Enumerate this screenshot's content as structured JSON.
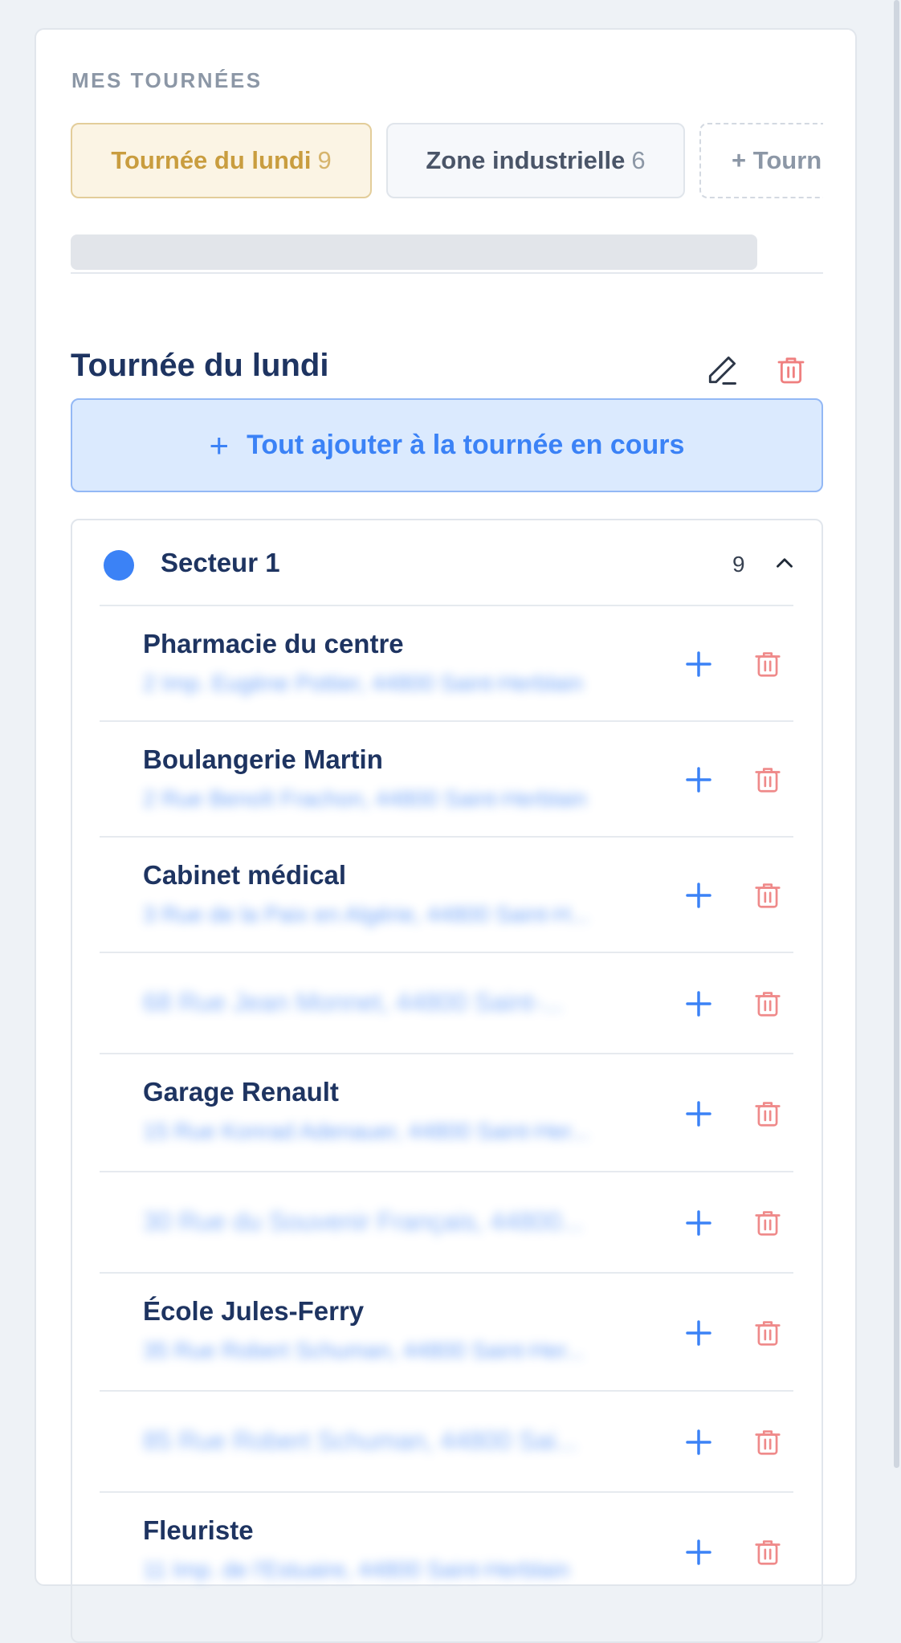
{
  "colors": {
    "accent_blue": "#3b82f6",
    "danger": "#ef8a8a",
    "active_tab_text": "#c99d3f",
    "title": "#1e3461"
  },
  "header": {
    "section_label": "MES TOURNÉES"
  },
  "tabs": [
    {
      "label": "Tournée du lundi",
      "count": "9",
      "active": true
    },
    {
      "label": "Zone industrielle",
      "count": "6",
      "active": false
    },
    {
      "label": "+ Tourn",
      "new": true
    }
  ],
  "tour": {
    "title": "Tournée du lundi",
    "edit_icon": "pencil-icon",
    "delete_icon": "trash-icon",
    "add_all_label": "Tout ajouter à la tournée en cours"
  },
  "sector": {
    "name": "Secteur 1",
    "count": "9",
    "color": "#3b82f6",
    "expanded": true,
    "items": [
      {
        "name": "Pharmacie du centre",
        "address": "2 Imp. Eugène Pottier, 44800 Saint-Herblain"
      },
      {
        "name": "Boulangerie Martin",
        "address": "2 Rue Benoît Frachon, 44800 Saint-Herblain"
      },
      {
        "name": "Cabinet médical",
        "address": "3 Rue de la Paix en Algérie, 44800 Saint-H..."
      },
      {
        "name": "",
        "address": "68 Rue Jean Monnet, 44800 Saint-..."
      },
      {
        "name": "Garage Renault",
        "address": "15 Rue Konrad Adenauer, 44800 Saint-Her..."
      },
      {
        "name": "",
        "address": "30 Rue du Souvenir Français, 44800..."
      },
      {
        "name": "École Jules-Ferry",
        "address": "35 Rue Robert Schuman, 44800 Saint-Her..."
      },
      {
        "name": "",
        "address": "85 Rue Robert Schuman, 44800 Sai..."
      },
      {
        "name": "Fleuriste",
        "address": "11 Imp. de l'Estuaire, 44800 Saint-Herblain"
      }
    ]
  }
}
